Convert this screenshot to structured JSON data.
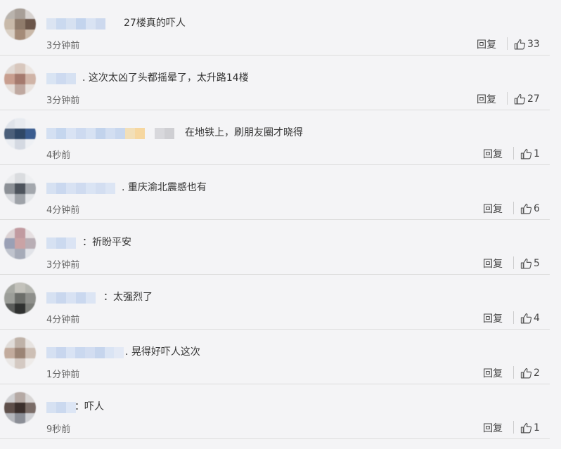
{
  "reply_label": "回复",
  "comments": [
    {
      "text": "27楼真的吓人",
      "time": "3分钟前",
      "likes": "33"
    },
    {
      "text": ". 这次太凶了头都摇晕了，太升路14楼",
      "time": "3分钟前",
      "likes": "27"
    },
    {
      "text": "在地铁上，刷朋友圈才晓得",
      "time": "4秒前",
      "likes": "1"
    },
    {
      "text": ". 重庆渝北震感也有",
      "time": "4分钟前",
      "likes": "6"
    },
    {
      "text": "：祈盼平安",
      "time": "3分钟前",
      "likes": "5"
    },
    {
      "text": "：太强烈了",
      "time": "4分钟前",
      "likes": "4"
    },
    {
      "text": ". 晃得好吓人这次",
      "time": "1分钟前",
      "likes": "2"
    },
    {
      "text": "：吓人",
      "time": "9秒前",
      "likes": "1"
    }
  ],
  "icons": {
    "like": "thumbs-up-icon"
  },
  "colors": {
    "background": "#f4f4f6",
    "divider": "#dcdcdc",
    "text": "#333333",
    "meta": "#666666"
  }
}
